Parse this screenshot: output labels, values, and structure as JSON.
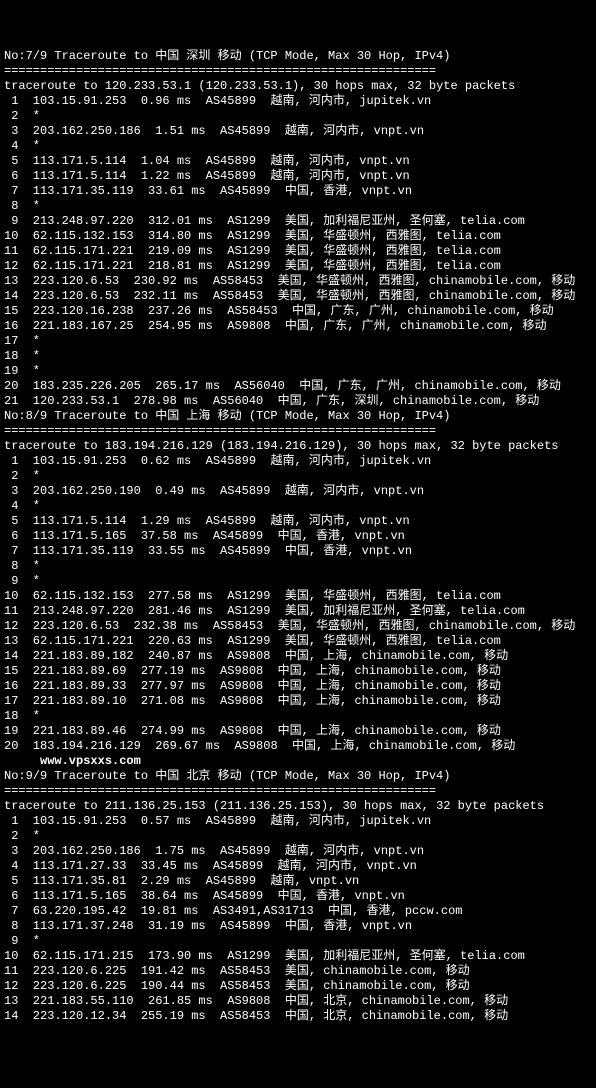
{
  "traceroutes": [
    {
      "header": "No:7/9 Traceroute to 中国 深圳 移动 (TCP Mode, Max 30 Hop, IPv4)",
      "div": "============================================================",
      "cmd": "traceroute to 120.233.53.1 (120.233.53.1), 30 hops max, 32 byte packets",
      "hops": [
        " 1  103.15.91.253  0.96 ms  AS45899  越南, 河内市, jupitek.vn",
        " 2  *",
        " 3  203.162.250.186  1.51 ms  AS45899  越南, 河内市, vnpt.vn",
        " 4  *",
        " 5  113.171.5.114  1.04 ms  AS45899  越南, 河内市, vnpt.vn",
        " 6  113.171.5.114  1.22 ms  AS45899  越南, 河内市, vnpt.vn",
        " 7  113.171.35.119  33.61 ms  AS45899  中国, 香港, vnpt.vn",
        " 8  *",
        " 9  213.248.97.220  312.01 ms  AS1299  美国, 加利福尼亚州, 圣何塞, telia.com",
        "10  62.115.132.153  314.80 ms  AS1299  美国, 华盛顿州, 西雅图, telia.com",
        "11  62.115.171.221  219.09 ms  AS1299  美国, 华盛顿州, 西雅图, telia.com",
        "12  62.115.171.221  218.81 ms  AS1299  美国, 华盛顿州, 西雅图, telia.com",
        "13  223.120.6.53  230.92 ms  AS58453  美国, 华盛顿州, 西雅图, chinamobile.com, 移动",
        "14  223.120.6.53  232.11 ms  AS58453  美国, 华盛顿州, 西雅图, chinamobile.com, 移动",
        "15  223.120.16.238  237.26 ms  AS58453  中国, 广东, 广州, chinamobile.com, 移动",
        "16  221.183.167.25  254.95 ms  AS9808  中国, 广东, 广州, chinamobile.com, 移动",
        "17  *",
        "18  *",
        "19  *",
        "20  183.235.226.205  265.17 ms  AS56040  中国, 广东, 广州, chinamobile.com, 移动",
        "21  120.233.53.1  278.98 ms  AS56040  中国, 广东, 深圳, chinamobile.com, 移动"
      ]
    },
    {
      "header": "No:8/9 Traceroute to 中国 上海 移动 (TCP Mode, Max 30 Hop, IPv4)",
      "div": "============================================================",
      "cmd": "traceroute to 183.194.216.129 (183.194.216.129), 30 hops max, 32 byte packets",
      "hops": [
        " 1  103.15.91.253  0.62 ms  AS45899  越南, 河内市, jupitek.vn",
        " 2  *",
        " 3  203.162.250.190  0.49 ms  AS45899  越南, 河内市, vnpt.vn",
        " 4  *",
        " 5  113.171.5.114  1.29 ms  AS45899  越南, 河内市, vnpt.vn",
        " 6  113.171.5.165  37.58 ms  AS45899  中国, 香港, vnpt.vn",
        " 7  113.171.35.119  33.55 ms  AS45899  中国, 香港, vnpt.vn",
        " 8  *",
        " 9  *",
        "10  62.115.132.153  277.58 ms  AS1299  美国, 华盛顿州, 西雅图, telia.com",
        "11  213.248.97.220  281.46 ms  AS1299  美国, 加利福尼亚州, 圣何塞, telia.com",
        "12  223.120.6.53  232.38 ms  AS58453  美国, 华盛顿州, 西雅图, chinamobile.com, 移动",
        "13  62.115.171.221  220.63 ms  AS1299  美国, 华盛顿州, 西雅图, telia.com",
        "14  221.183.89.182  240.87 ms  AS9808  中国, 上海, chinamobile.com, 移动",
        "15  221.183.89.69  277.19 ms  AS9808  中国, 上海, chinamobile.com, 移动",
        "16  221.183.89.33  277.97 ms  AS9808  中国, 上海, chinamobile.com, 移动",
        "17  221.183.89.10  271.08 ms  AS9808  中国, 上海, chinamobile.com, 移动",
        "18  *",
        "19  221.183.89.46  274.99 ms  AS9808  中国, 上海, chinamobile.com, 移动",
        "20  183.194.216.129  269.67 ms  AS9808  中国, 上海, chinamobile.com, 移动"
      ]
    },
    {
      "header": "No:9/9 Traceroute to 中国 北京 移动 (TCP Mode, Max 30 Hop, IPv4)",
      "div": "============================================================",
      "cmd": "traceroute to 211.136.25.153 (211.136.25.153), 30 hops max, 32 byte packets",
      "watermark": "www.vpsxxs.com",
      "hops": [
        " 1  103.15.91.253  0.57 ms  AS45899  越南, 河内市, jupitek.vn",
        " 2  *",
        " 3  203.162.250.186  1.75 ms  AS45899  越南, 河内市, vnpt.vn",
        " 4  113.171.27.33  33.45 ms  AS45899  越南, 河内市, vnpt.vn",
        " 5  113.171.35.81  2.29 ms  AS45899  越南, vnpt.vn",
        " 6  113.171.5.165  38.64 ms  AS45899  中国, 香港, vnpt.vn",
        " 7  63.220.195.42  19.81 ms  AS3491,AS31713  中国, 香港, pccw.com",
        " 8  113.171.37.248  31.19 ms  AS45899  中国, 香港, vnpt.vn",
        " 9  *",
        "10  62.115.171.215  173.90 ms  AS1299  美国, 加利福尼亚州, 圣何塞, telia.com",
        "11  223.120.6.225  191.42 ms  AS58453  美国, chinamobile.com, 移动",
        "12  223.120.6.225  190.44 ms  AS58453  美国, chinamobile.com, 移动",
        "13  221.183.55.110  261.85 ms  AS9808  中国, 北京, chinamobile.com, 移动",
        "14  223.120.12.34  255.19 ms  AS58453  中国, 北京, chinamobile.com, 移动"
      ]
    }
  ]
}
